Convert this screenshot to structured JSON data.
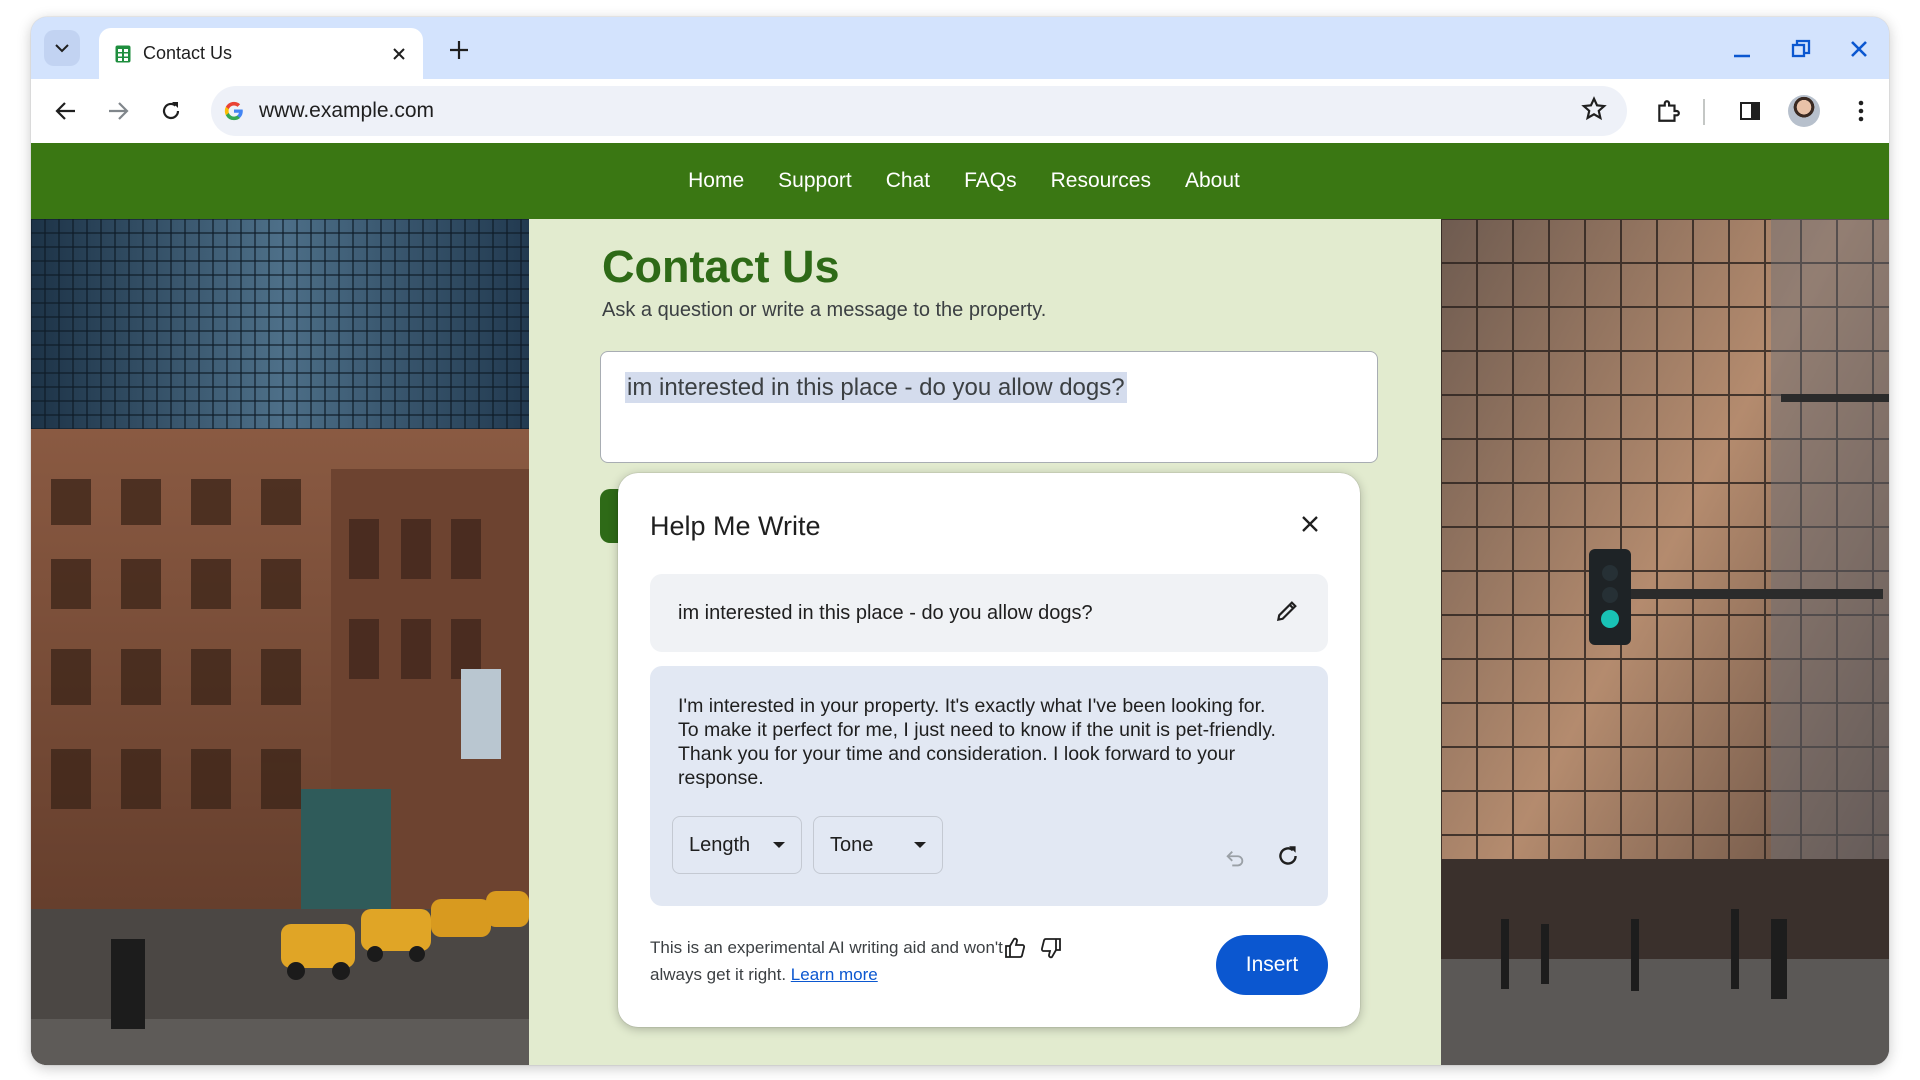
{
  "browser": {
    "tab_title": "Contact Us",
    "url": "www.example.com"
  },
  "site": {
    "nav": [
      "Home",
      "Support",
      "Chat",
      "FAQs",
      "Resources",
      "About"
    ],
    "accent": "#3a7713"
  },
  "contact": {
    "title": "Contact Us",
    "subtitle": "Ask a question or write a message to the property.",
    "message": "im interested in this place - do you allow dogs?"
  },
  "help_me_write": {
    "title": "Help Me Write",
    "prompt": "im interested in this place - do you allow dogs?",
    "result": "I'm interested in your property. It's exactly what I've been looking for. To make it perfect for me, I just need to know if the unit is pet-friendly. Thank you for your time and consideration. I look forward to your response.",
    "length_label": "Length",
    "tone_label": "Tone",
    "disclaimer": "This is an experimental AI writing aid and won't always get it right.",
    "learn_more": "Learn more",
    "insert_label": "Insert",
    "button_color": "#0b57d0"
  }
}
